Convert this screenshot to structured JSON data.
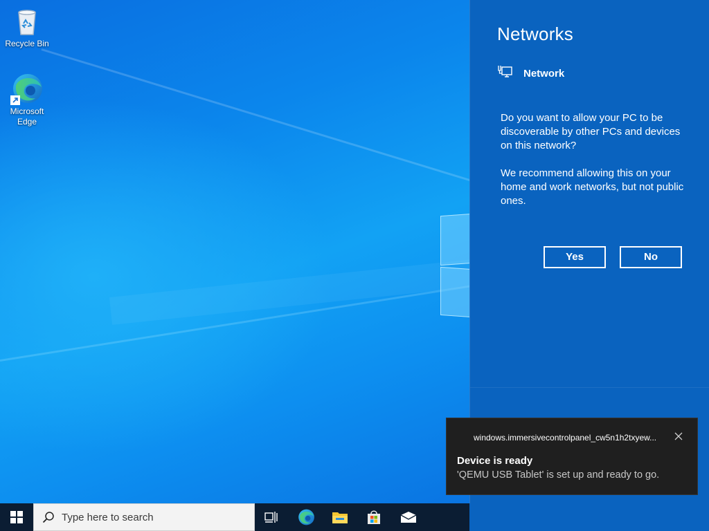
{
  "desktop": {
    "icons": [
      {
        "label": "Recycle Bin",
        "icon": "recycle-bin-icon"
      },
      {
        "label": "Microsoft Edge",
        "icon": "edge-icon"
      }
    ]
  },
  "panel": {
    "title": "Networks",
    "network_name": "Network",
    "network_icon": "wired-network-icon",
    "question": "Do you want to allow your PC to be discoverable by other PCs and devices on this network?",
    "recommendation": "We recommend allowing this on your home and work networks, but not public ones.",
    "yes_label": "Yes",
    "no_label": "No",
    "background_color": "#0a63bf"
  },
  "toast": {
    "app_name": "windows.immersivecontrolpanel_cw5n1h2txyew...",
    "title": "Device is ready",
    "body": "'QEMU USB Tablet' is set up and ready to go.",
    "close_icon": "close-icon"
  },
  "taskbar": {
    "search_placeholder": "Type here to search",
    "pinned": [
      "task-view-icon",
      "edge-icon",
      "file-explorer-icon",
      "store-icon",
      "mail-icon"
    ]
  }
}
